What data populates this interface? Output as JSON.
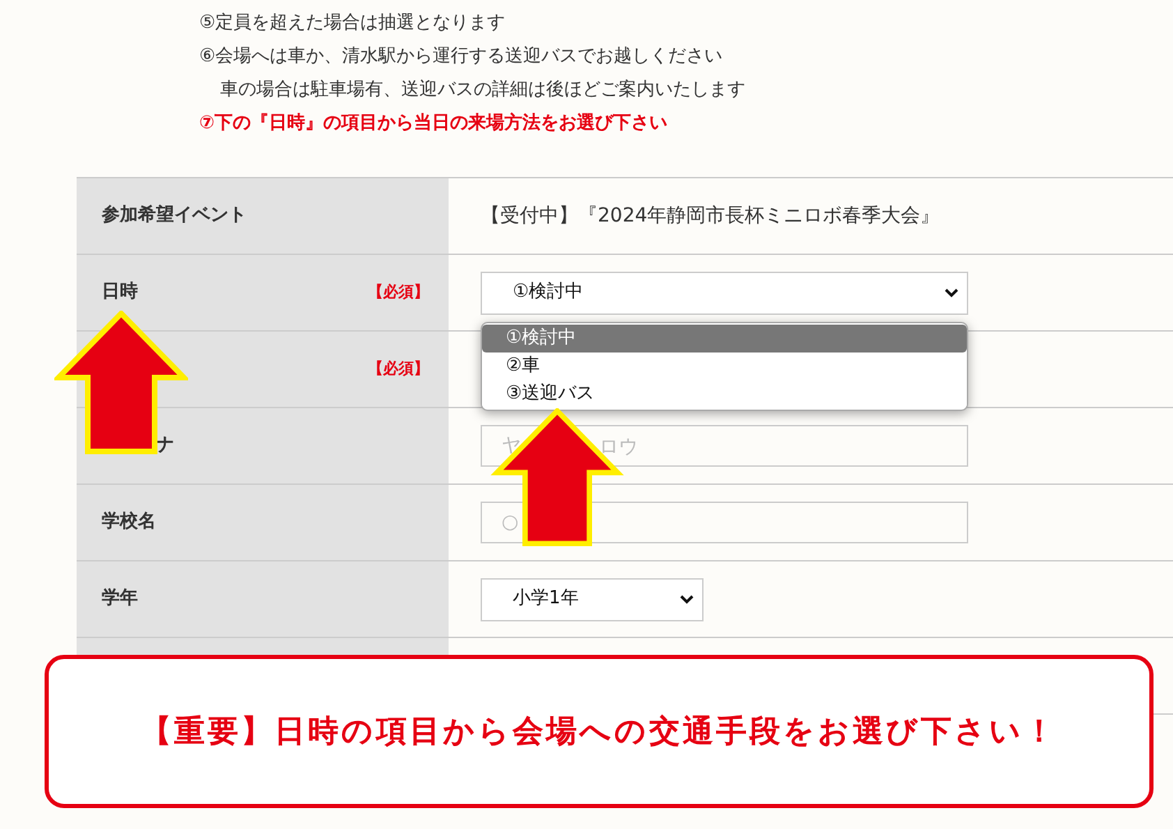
{
  "notes": [
    {
      "kind": "item",
      "text": "⑤定員を超えた場合は抽選となります"
    },
    {
      "kind": "item",
      "text": "⑥会場へは車か、清水駅から運行する送迎バスでお越しください"
    },
    {
      "kind": "continuation",
      "text": "車の場合は駐車場有、送迎バスの詳細は後ほどご案内いたします"
    },
    {
      "kind": "highlight",
      "text": "⑦下の『日時』の項目から当日の来場方法をお選び下さい"
    }
  ],
  "form": {
    "rows": [
      {
        "label": "参加希望イベント",
        "required": false,
        "covered": false,
        "field": {
          "kind": "text",
          "value": "【受付中】『2024年静岡市長杯ミニロボ春季大会』"
        }
      },
      {
        "label": "日時",
        "required": true,
        "required_text": "【必須】",
        "covered": false,
        "field": {
          "kind": "select",
          "value": "①検討中",
          "open": true,
          "options": [
            {
              "label": "①検討中",
              "selected": true
            },
            {
              "label": "②車",
              "selected": false
            },
            {
              "label": "③送迎バス",
              "selected": false
            }
          ]
        }
      },
      {
        "required": true,
        "required_text": "【必須】",
        "field": {
          "kind": "blank"
        }
      },
      {
        "label": "ナ",
        "required": false,
        "covered": true,
        "field": {
          "kind": "input",
          "placeholder": "ヤ",
          "placeholder_tail": "ロウ"
        }
      },
      {
        "label": "学校名",
        "required": false,
        "covered": false,
        "field": {
          "kind": "input",
          "placeholder": "○"
        }
      },
      {
        "label": "学年",
        "required": false,
        "covered": false,
        "field": {
          "kind": "select",
          "value": "小学1年",
          "open": false,
          "narrow": true
        }
      },
      {
        "required": false,
        "field": {
          "kind": "blank"
        }
      }
    ]
  },
  "callout": {
    "text": "【重要】日時の項目から会場への交通手段をお選び下さい！"
  }
}
